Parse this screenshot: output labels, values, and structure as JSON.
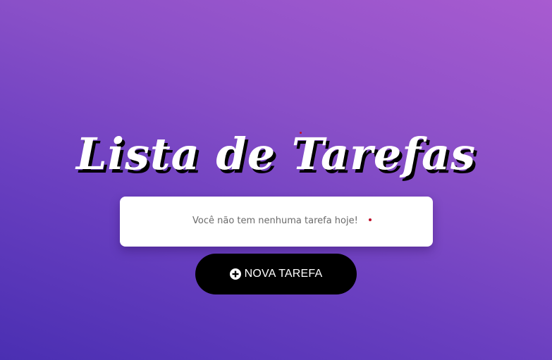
{
  "header": {
    "title": "Lista de Tarefas"
  },
  "task_list": {
    "empty_message": "Você não tem nenhuma tarefa hoje!"
  },
  "actions": {
    "new_task_label": "NOVA TAREFA",
    "new_task_icon": "plus-circle-icon"
  },
  "colors": {
    "background_gradient_start": "#4a2fb2",
    "background_gradient_end": "#a85bd0",
    "card_background": "#ffffff",
    "button_background": "#000000",
    "button_text": "#ffffff"
  }
}
